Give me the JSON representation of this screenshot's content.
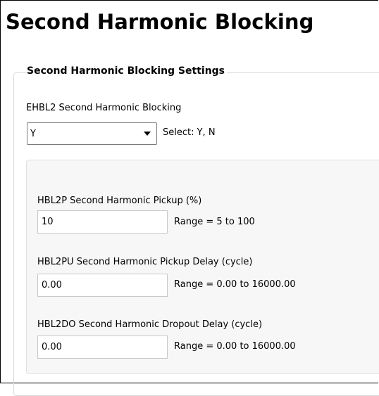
{
  "page": {
    "title": "Second Harmonic Blocking"
  },
  "group": {
    "legend": "Second Harmonic Blocking Settings"
  },
  "ehbl2": {
    "label": "EHBL2  Second Harmonic Blocking",
    "selected": "Y",
    "hint": "Select: Y, N"
  },
  "hbl2p": {
    "label": "HBL2P  Second Harmonic Pickup (%)",
    "value": "10",
    "range": "Range = 5 to 100"
  },
  "hbl2pu": {
    "label": "HBL2PU  Second Harmonic Pickup Delay (cycle)",
    "value": "0.00",
    "range": "Range = 0.00 to 16000.00"
  },
  "hbl2do": {
    "label": "HBL2DO  Second Harmonic Dropout Delay (cycle)",
    "value": "0.00",
    "range": "Range = 0.00 to 16000.00"
  },
  "icons": {
    "dropdown": "chevron-down-icon"
  }
}
